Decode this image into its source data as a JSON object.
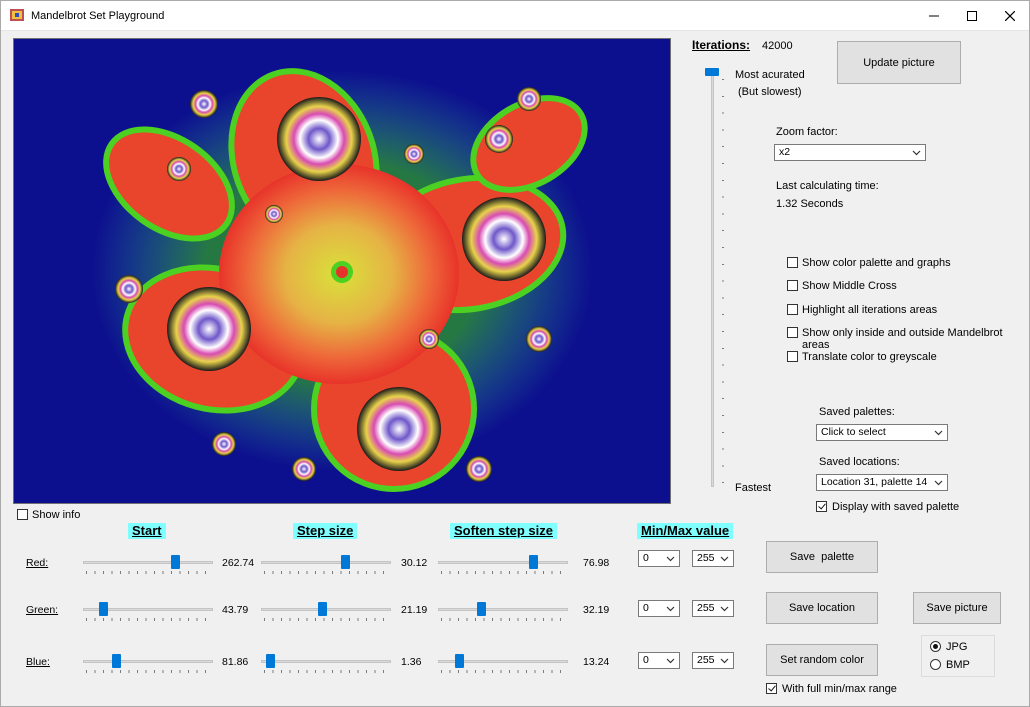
{
  "window": {
    "title": "Mandelbrot Set Playground",
    "minimize_icon": "minimize-icon",
    "maximize_icon": "maximize-icon",
    "close_icon": "close-icon"
  },
  "iterations": {
    "label": "Iterations:",
    "value": "42000",
    "top_label": "Most acurated",
    "top_sublabel": "(But slowest)",
    "bottom_label": "Fastest",
    "slider_level": 1.0
  },
  "update_button": "Update picture",
  "zoom": {
    "label": "Zoom factor:",
    "value": "x2"
  },
  "timing": {
    "label": "Last calculating time:",
    "value": "1.32 Seconds"
  },
  "options": [
    {
      "label": "Show color palette and graphs",
      "checked": false
    },
    {
      "label": "Show Middle Cross",
      "checked": false
    },
    {
      "label": "Highlight all iterations areas",
      "checked": false
    },
    {
      "label": "Show only inside and outside Mandelbrot areas",
      "checked": false
    },
    {
      "label": "Translate color to greyscale",
      "checked": false
    }
  ],
  "saved_palettes": {
    "label": "Saved palettes:",
    "value": "Click to select"
  },
  "saved_locations": {
    "label": "Saved locations:",
    "value": "Location 31, palette 14"
  },
  "display_saved_palette": {
    "label": "Display with saved palette",
    "checked": true
  },
  "show_info": {
    "label": "Show info",
    "checked": false
  },
  "headers": {
    "start": "Start",
    "step": "Step size",
    "soften": "Soften step size",
    "minmax": "Min/Max value"
  },
  "rows": [
    {
      "label": "Red:",
      "start": "262.74",
      "step": "30.12",
      "soften": "76.98",
      "min": "0",
      "max": "255",
      "start_level": 0.73,
      "step_level": 0.66,
      "soften_level": 0.75
    },
    {
      "label": "Green:",
      "start": "43.79",
      "step": "21.19",
      "soften": "32.19",
      "min": "0",
      "max": "255",
      "start_level": 0.13,
      "step_level": 0.47,
      "soften_level": 0.32
    },
    {
      "label": "Blue:",
      "start": "81.86",
      "step": "1.36",
      "soften": "13.24",
      "min": "0",
      "max": "255",
      "start_level": 0.24,
      "step_level": 0.04,
      "soften_level": 0.14
    }
  ],
  "buttons": {
    "save_palette": "Save  palette",
    "save_location": "Save location",
    "save_picture": "Save picture",
    "random_color": "Set random color"
  },
  "full_range": {
    "label": "With full min/max range",
    "checked": true
  },
  "format": {
    "jpg": "JPG",
    "bmp": "BMP",
    "selected": "JPG"
  },
  "colors": {
    "fractal_bg": "#0d108e",
    "slider_thumb": "#0078d7",
    "header_highlight": "#7fffff"
  }
}
